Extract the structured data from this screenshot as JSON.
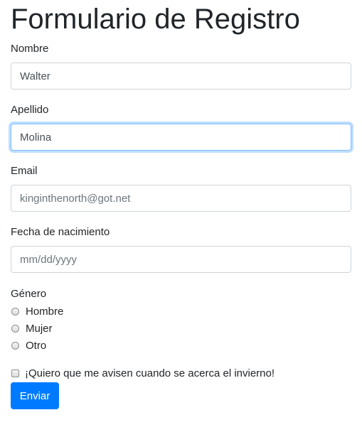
{
  "form": {
    "title": "Formulario de Registro",
    "nombre": {
      "label": "Nombre",
      "value": "Walter",
      "placeholder": ""
    },
    "apellido": {
      "label": "Apellido",
      "value": "Molina",
      "placeholder": ""
    },
    "email": {
      "label": "Email",
      "value": "",
      "placeholder": "kinginthenorth@got.net"
    },
    "fecha": {
      "label": "Fecha de nacimiento",
      "value": "",
      "placeholder": "mm/dd/yyyy"
    },
    "genero": {
      "label": "Género",
      "options": [
        "Hombre",
        "Mujer",
        "Otro"
      ]
    },
    "notify_label": "¡Quiero que me avisen cuando se acerca el invierno!",
    "submit_label": "Enviar"
  },
  "colors": {
    "primary": "#007bff",
    "focus_border": "#80bdff",
    "input_border": "#ced4da"
  }
}
